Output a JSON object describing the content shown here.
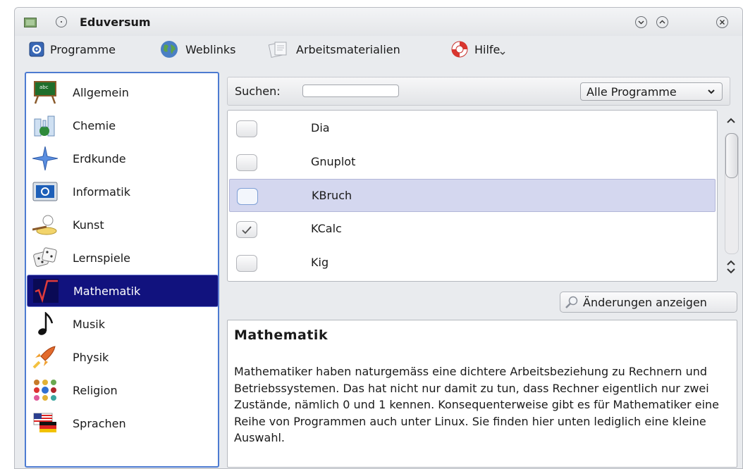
{
  "window": {
    "title": "Eduversum"
  },
  "menubar": {
    "items": [
      {
        "label": "Programme",
        "icon": "settings-icon"
      },
      {
        "label": "Weblinks",
        "icon": "globe-icon"
      },
      {
        "label": "Arbeitsmaterialien",
        "icon": "documents-icon"
      },
      {
        "label": "Hilfe",
        "icon": "lifebuoy-icon"
      }
    ]
  },
  "sidebar": {
    "items": [
      {
        "label": "Allgemein",
        "icon": "chalkboard-icon"
      },
      {
        "label": "Chemie",
        "icon": "lab-flask-icon"
      },
      {
        "label": "Erdkunde",
        "icon": "compass-star-icon"
      },
      {
        "label": "Informatik",
        "icon": "computer-icon"
      },
      {
        "label": "Kunst",
        "icon": "paint-icon"
      },
      {
        "label": "Lernspiele",
        "icon": "dice-icon"
      },
      {
        "label": "Mathematik",
        "icon": "sqrt-icon",
        "selected": true
      },
      {
        "label": "Musik",
        "icon": "music-note-icon"
      },
      {
        "label": "Physik",
        "icon": "rocket-icon"
      },
      {
        "label": "Religion",
        "icon": "religion-symbols-icon"
      },
      {
        "label": "Sprachen",
        "icon": "flags-icon"
      }
    ]
  },
  "search": {
    "label": "Suchen:",
    "value": "",
    "filter": "Alle Programme"
  },
  "programs": [
    {
      "name": "Dia",
      "checked": false
    },
    {
      "name": "Gnuplot",
      "checked": false
    },
    {
      "name": "KBruch",
      "checked": false,
      "highlighted": true
    },
    {
      "name": "KCalc",
      "checked": true
    },
    {
      "name": "Kig",
      "checked": false
    }
  ],
  "actions": {
    "show_changes": "Änderungen anzeigen"
  },
  "description": {
    "title": "Mathematik",
    "text": "Mathematiker haben naturgemäss eine dichtere Arbeitsbeziehung zu Rechnern und Betriebssystemen. Das hat nicht nur damit zu tun, dass Rechner eigentlich nur zwei Zustände, nämlich 0 und 1 kennen. Konsequenterweise gibt es für Mathematiker eine Reihe von Programmen auch unter Linux. Sie finden hier unten lediglich eine kleine Auswahl."
  },
  "colors": {
    "selection": "#11127e",
    "row_highlight": "#d4d7ef",
    "sidebar_border": "#4d7bd1"
  }
}
